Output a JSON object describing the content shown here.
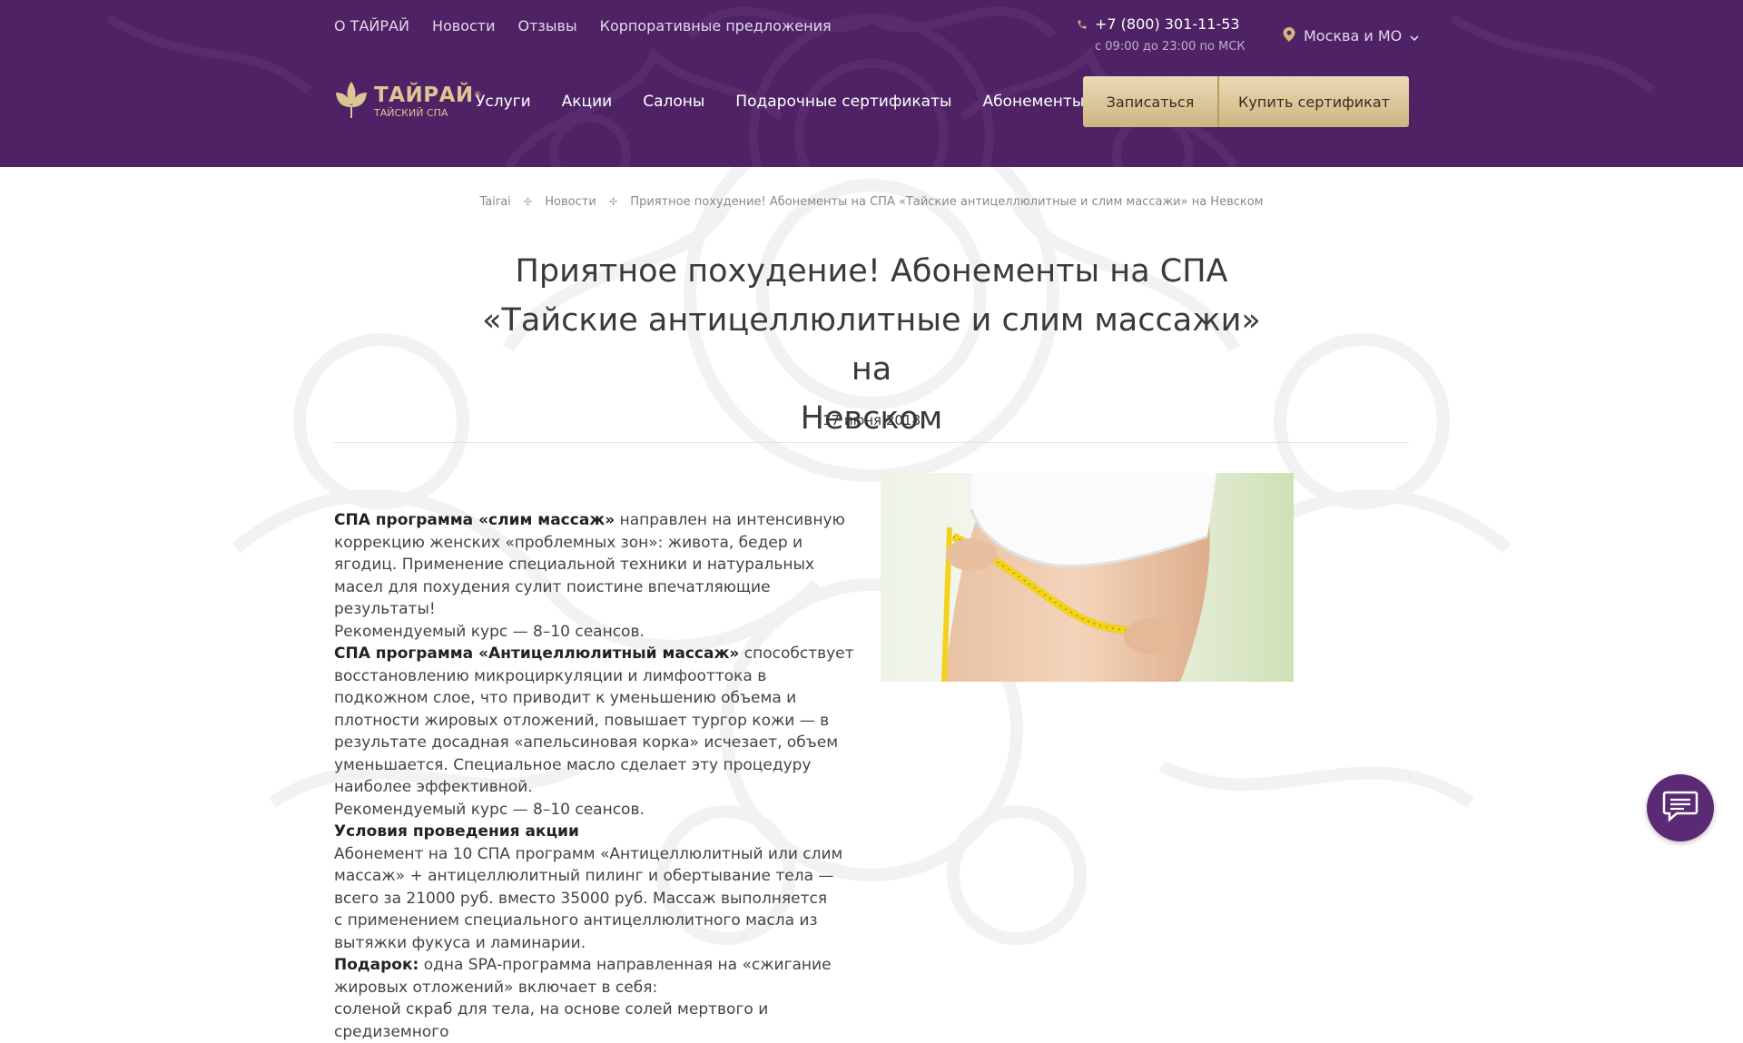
{
  "header": {
    "top_links": [
      "О ТАЙРАЙ",
      "Новости",
      "Отзывы",
      "Корпоративные предложения"
    ],
    "phone": "+7 (800) 301-11-53",
    "phone_hours": "с 09:00 до 23:00 по МСК",
    "city": "Москва и МО",
    "logo_title": "ТАЙРАЙ",
    "logo_registered": "®",
    "logo_subtitle": "ТАЙСКИЙ СПА",
    "main_nav": [
      "Услуги",
      "Акции",
      "Салоны",
      "Подарочные сертификаты",
      "Абонементы"
    ],
    "book_button": "Записаться",
    "certificate_button": "Купить сертификат"
  },
  "breadcrumb": {
    "items": [
      "Tairai",
      "Новости",
      "Приятное похудение! Абонементы на СПА «Тайские антицеллюлитные и слим массажи» на Невском"
    ]
  },
  "article": {
    "title_lines": [
      "Приятное похудение! Абонементы на СПА",
      "«Тайские антицеллюлитные и слим массажи» на",
      "Невском"
    ],
    "date": "17 июня 2018",
    "p1_bold": "СПА программа «слим массаж»",
    "p1_text": " направлен на интенсивную коррекцию женских «проблемных зон»: живота, бедер и ягодиц. Применение специальной техники и натуральных масел для похудения сулит поистине впечатляющие результаты!",
    "p1_course": "Рекомендуемый курс — 8–10 сеансов.",
    "p2_bold": "СПА программа «Антицеллюлитный массаж»",
    "p2_text": " способствует восстановлению микроциркуляции и лимфооттока в подкожном слое, что приводит к уменьшению объема и плотности жировых отложений, повышает тургор кожи — в результате досадная «апельсиновая корка» исчезает, объем уменьшается. Специальное масло сделает эту процедуру наиболее эффективной.",
    "p2_course": "Рекомендуемый курс — 8–10 сеансов.",
    "conditions_heading": "Условия проведения акции",
    "conditions_text_1": "Абонемент на 10 СПА программ «Антицеллюлитный или слим массаж» + антицеллюлитный пилинг и обертывание тела — всего за 21000 руб. вместо 35000 руб. Массаж выполняется",
    "conditions_text_2": "с применением специального антицеллюлитного масла из вытяжки фукуса и ламинарии.",
    "gift_bold": "Подарок:",
    "gift_text": " одна SPA-программа направленная на «сжигание жировых отложений» включает в себя:",
    "gift_item": "соленой скраб для тела, на основе солей мертвого и средиземного"
  },
  "colors": {
    "header_bg": "#4e2265",
    "gold_button": "#d9c495",
    "chat_button": "#5b2a75"
  },
  "icons": {
    "phone": "phone-icon",
    "location": "location-pin-icon",
    "dropdown": "chevron-down-icon",
    "logo": "lotus-leaves-icon",
    "breadcrumb_separator": "leaf-separator-icon",
    "chat": "chat-bubble-icon"
  }
}
